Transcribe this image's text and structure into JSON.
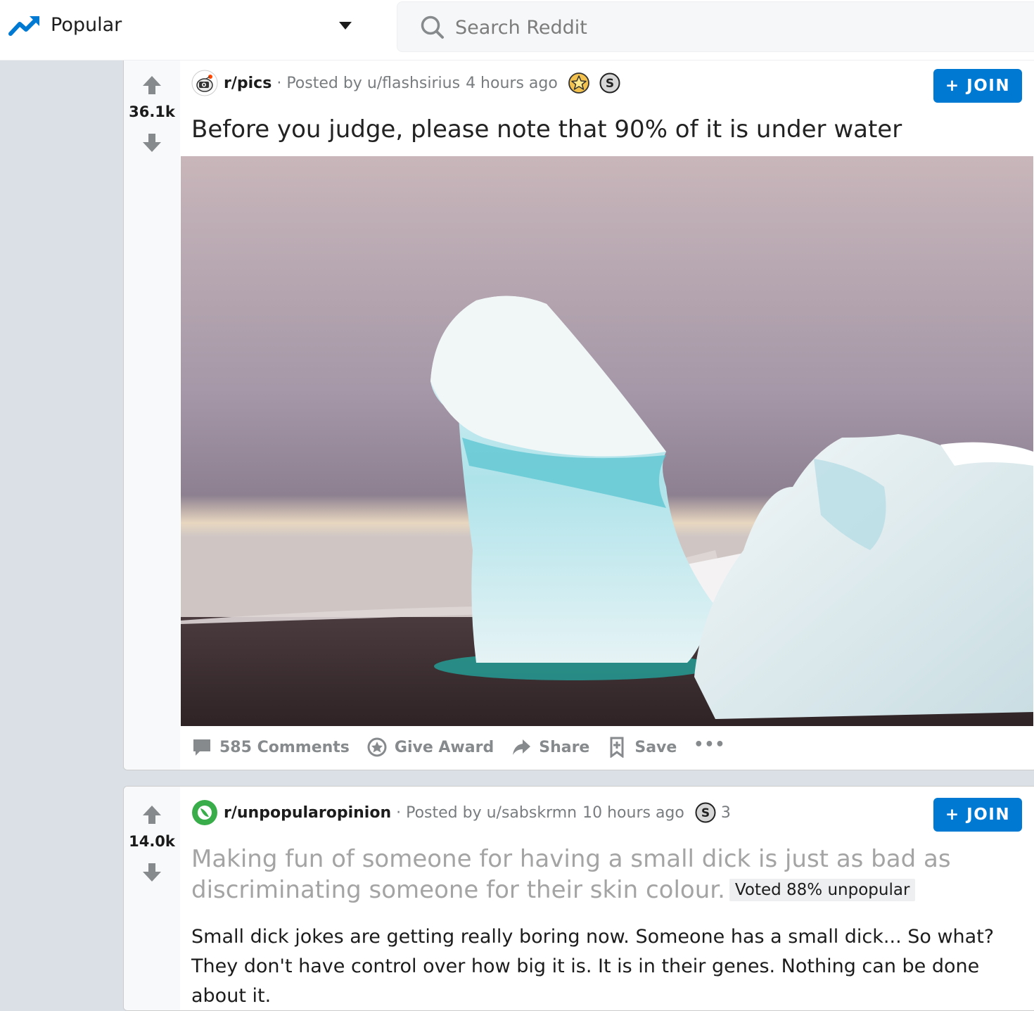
{
  "header": {
    "feed_label": "Popular",
    "feed_icon": "trending-up-icon",
    "search_placeholder": "Search Reddit"
  },
  "posts": [
    {
      "votes": "36.1k",
      "subreddit": "r/pics",
      "posted_by": "Posted by u/flashsirius",
      "time": "4 hours ago",
      "awards": [
        "gold-award-icon",
        "silver-award-icon"
      ],
      "join_label": "+ JOIN",
      "title": "Before you judge, please note that 90% of it is under water",
      "image": "iceberg-photo",
      "actions": {
        "comments": "585 Comments",
        "award": "Give Award",
        "share": "Share",
        "save": "Save",
        "more": "•••"
      }
    },
    {
      "votes": "14.0k",
      "subreddit": "r/unpopularopinion",
      "posted_by": "Posted by u/sabskrmn",
      "time": "10 hours ago",
      "award_count": "3",
      "join_label": "+ JOIN",
      "title": "Making fun of someone for having a small dick is just as bad as discriminating someone for their skin colour.",
      "flair": "Voted 88% unpopular",
      "body": "Small dick jokes are getting really boring now. Someone has a small dick... So what? They don't have control over how big it is. It is in their genes. Nothing can be done about it."
    }
  ],
  "colors": {
    "accent": "#0079d3",
    "background": "#dae0e6",
    "meta_text": "#787c7e"
  }
}
